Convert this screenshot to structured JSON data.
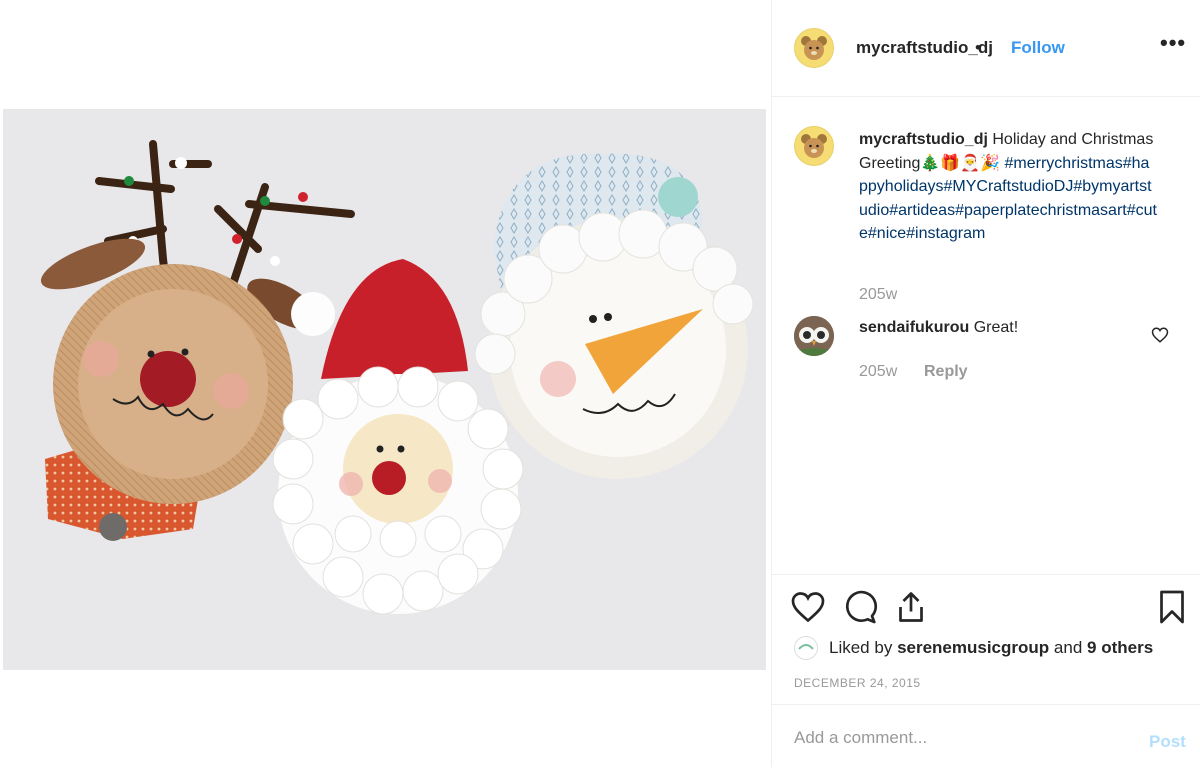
{
  "post": {
    "username": "mycraftstudio_dj",
    "separator": "•",
    "follow_label": "Follow",
    "more_label": "•••",
    "photo_alt": "Paper plate Christmas crafts: reindeer, Santa and snowman"
  },
  "caption": {
    "username": "mycraftstudio_dj",
    "text": "Holiday and Christmas Greeting",
    "emojis": "🎄🎁🎅🎉",
    "hashtags": "#merrychristmas#happyholidays#MYCraftstudioDJ#bymyartstudio#artideas#paperplatechristmasart#cute#nice#instagram",
    "timestamp": "205w"
  },
  "comments": [
    {
      "username": "sendaifukurou",
      "text": "Great!",
      "timestamp": "205w",
      "reply_label": "Reply"
    }
  ],
  "engagement": {
    "liked_prefix": "Liked by",
    "liked_user": "serenemusicgroup",
    "liked_and": "and",
    "liked_others": "9 others",
    "date": "DECEMBER 24, 2015"
  },
  "add_comment": {
    "placeholder": "Add a comment...",
    "post_label": "Post"
  },
  "icons": {
    "like": "heart-icon",
    "comment": "comment-icon",
    "share": "share-icon",
    "save": "bookmark-icon",
    "more": "more-options-icon"
  },
  "colors": {
    "link": "#3897f0",
    "hashtag": "#003569",
    "muted": "#999999",
    "post_disabled": "#b2dffc"
  }
}
